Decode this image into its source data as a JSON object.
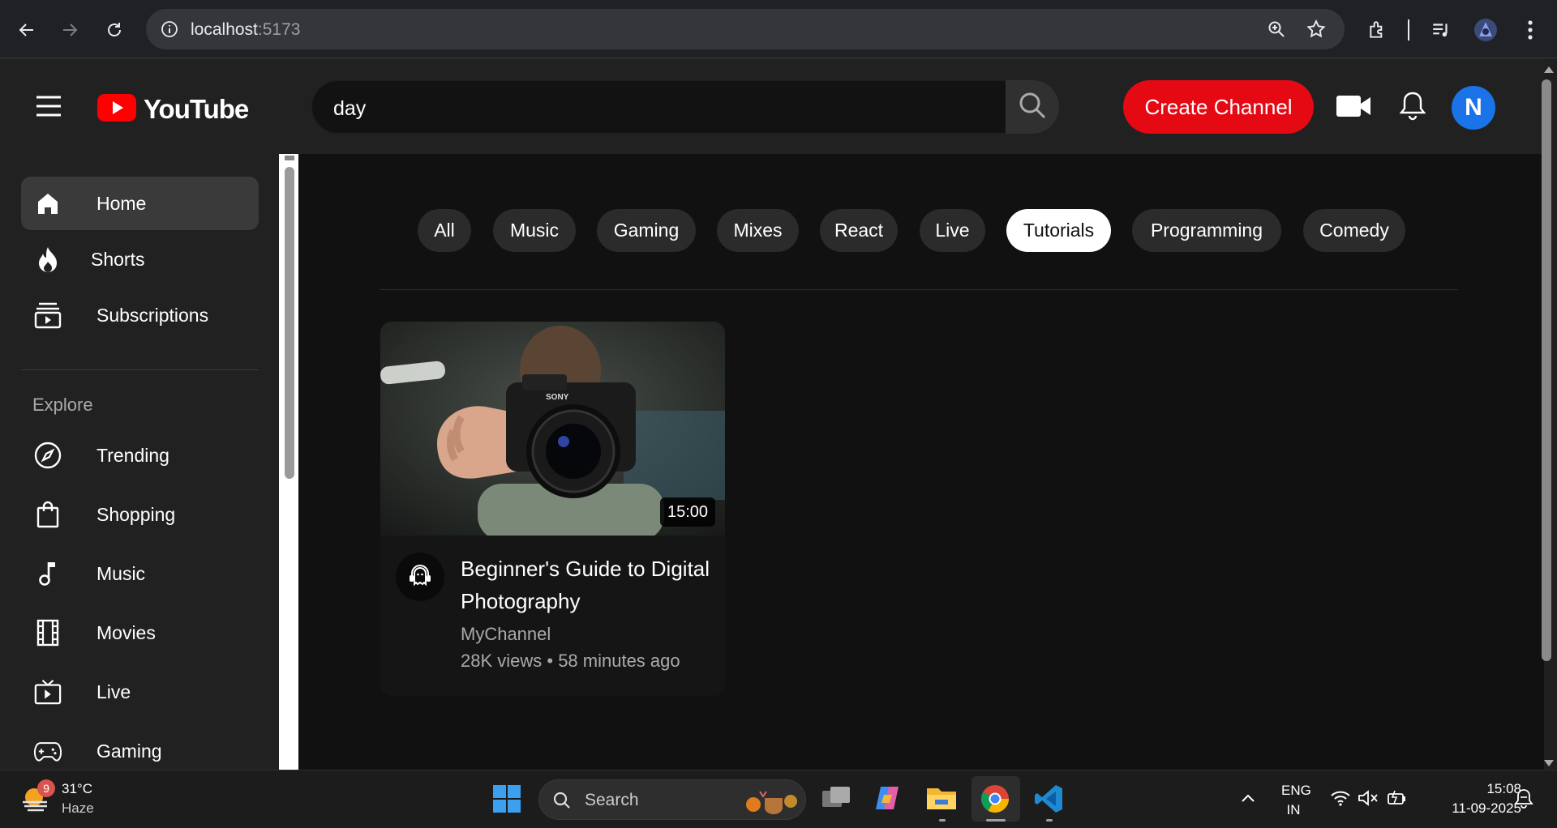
{
  "browser": {
    "url_host": "localhost",
    "url_port": ":5173"
  },
  "header": {
    "logo_text": "YouTube",
    "search_value": "day",
    "create_label": "Create Channel",
    "avatar_letter": "N"
  },
  "sidebar": {
    "items": [
      {
        "label": "Home",
        "icon": "home-icon",
        "active": true
      },
      {
        "label": "Shorts",
        "icon": "flame-icon"
      },
      {
        "label": "Subscriptions",
        "icon": "subscriptions-icon"
      }
    ],
    "explore_heading": "Explore",
    "explore_items": [
      {
        "label": "Trending",
        "icon": "compass-icon"
      },
      {
        "label": "Shopping",
        "icon": "shopping-bag-icon"
      },
      {
        "label": "Music",
        "icon": "music-note-icon"
      },
      {
        "label": "Movies",
        "icon": "film-icon"
      },
      {
        "label": "Live",
        "icon": "live-tv-icon"
      },
      {
        "label": "Gaming",
        "icon": "gamepad-icon"
      }
    ]
  },
  "chips": [
    "All",
    "Music",
    "Gaming",
    "Mixes",
    "React",
    "Live",
    "Tutorials",
    "Programming",
    "Comedy"
  ],
  "active_chip": "Tutorials",
  "video": {
    "duration": "15:00",
    "title": "Beginner's Guide to Digital Photography",
    "channel": "MyChannel",
    "meta": "28K views • 58 minutes ago"
  },
  "taskbar": {
    "weather_badge": "9",
    "temperature": "31°C",
    "condition": "Haze",
    "search_label": "Search",
    "lang_top": "ENG",
    "lang_bottom": "IN",
    "time": "15:08",
    "date": "11-09-2025"
  },
  "colors": {
    "brand_red": "#e50914",
    "avatar_blue": "#1a73e8",
    "background": "#0f0f0f"
  }
}
